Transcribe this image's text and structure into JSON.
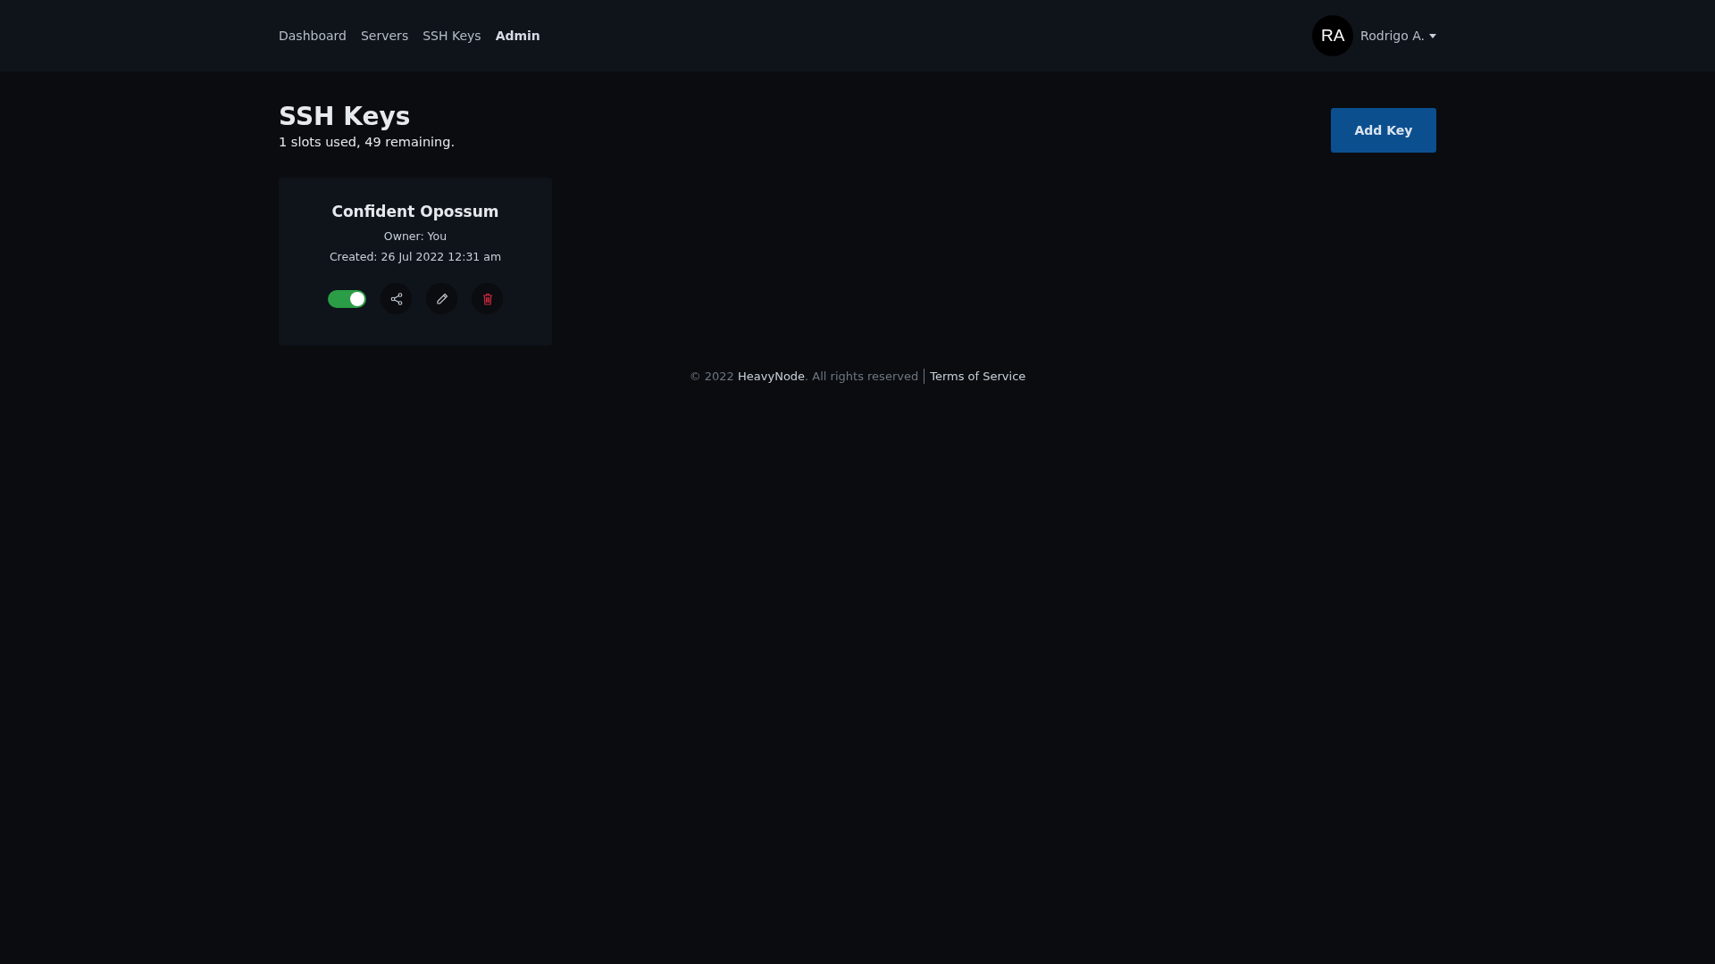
{
  "nav": {
    "links": [
      {
        "label": "Dashboard",
        "selected": false
      },
      {
        "label": "Servers",
        "selected": false
      },
      {
        "label": "SSH Keys",
        "selected": false
      },
      {
        "label": "Admin",
        "selected": true
      }
    ],
    "user": {
      "initials": "RA",
      "name": "Rodrigo A."
    }
  },
  "page": {
    "title": "SSH Keys",
    "subtitle": "1 slots used, 49 remaining.",
    "add_button": "Add Key"
  },
  "keys": [
    {
      "name": "Confident Opossum",
      "owner": "Owner: You",
      "created": "Created: 26 Jul 2022 12:31 am",
      "on": true
    }
  ],
  "footer": {
    "prefix": "© 2022 ",
    "brand": "HeavyNode",
    "suffix": ". All rights reserved",
    "terms": "Terms of Service"
  }
}
